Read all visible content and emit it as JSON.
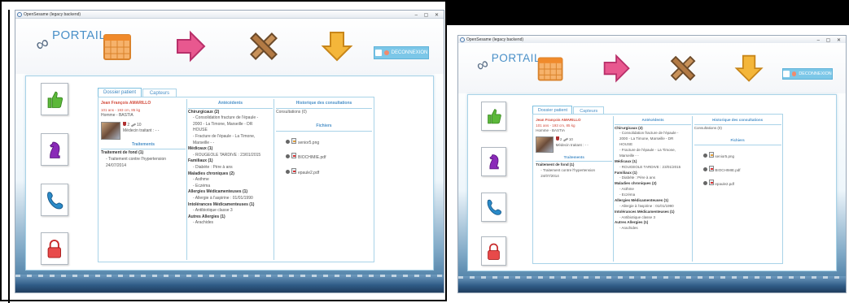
{
  "window": {
    "title": "OpenSesame (legacy backend)",
    "controls": "–  ▢  ✕"
  },
  "header": {
    "logo_text": "PORTAIL",
    "nav_icons": [
      "calendar-icon",
      "arrow-right-icon",
      "tools-icon",
      "arrow-down-icon"
    ],
    "disconnect_label": "DECONNEXION"
  },
  "sidebar": {
    "icons": [
      "thumbs-up-icon",
      "chess-knight-icon",
      "phone-icon",
      "padlock-icon"
    ]
  },
  "tabs": [
    "Dossier patient",
    "Capteurs"
  ],
  "patient": {
    "name": "Jean François AMARILLO",
    "details": "101 ans - 193 cm, 85 kg",
    "sex_city": "Homme - BASTIA",
    "wine": "2",
    "cigarettes": "10",
    "doctor": "Médecin traitant : - -"
  },
  "treatments": {
    "header": "Traitements",
    "title": "Traitement de fond (1)",
    "item": "- Traitement contre l'hypertension",
    "date": "24/07/2014"
  },
  "antecedents": {
    "header": "Antécédents",
    "lines": [
      {
        "t": "Chirurgicaux (2)",
        "s": "b"
      },
      {
        "t": "- Consolidation fracture de l'épaule -",
        "s": "ind"
      },
      {
        "t": "2000 - La Timone, Marseille - DR",
        "s": "ind"
      },
      {
        "t": "HOUSE",
        "s": "ind"
      },
      {
        "t": "- Fracture de l'épaule - La Timone,",
        "s": "ind"
      },
      {
        "t": "Marseille - -",
        "s": "ind"
      },
      {
        "t": "Médicaux (1)",
        "s": "b"
      },
      {
        "t": "- ROUGEOLE TARDIVE : 23/01/2015",
        "s": "ind"
      },
      {
        "t": "Familiaux (1)",
        "s": "b"
      },
      {
        "t": "- Diabète : Père à ans",
        "s": "ind"
      },
      {
        "t": "Maladies chroniques (2)",
        "s": "b"
      },
      {
        "t": "- Asthme",
        "s": "ind"
      },
      {
        "t": "- Eczéma",
        "s": "ind"
      },
      {
        "t": "Allergies Médicamenteuses (1)",
        "s": "b"
      },
      {
        "t": "- Allergie à l'aspirine : 01/01/1990",
        "s": "ind"
      },
      {
        "t": "Intolérances Médicamenteuses (1)",
        "s": "b"
      },
      {
        "t": "- Antibiotique classe 3",
        "s": "ind"
      },
      {
        "t": "Autres Allergies (1)",
        "s": "b"
      },
      {
        "t": "- Arachides",
        "s": "ind"
      }
    ]
  },
  "history": {
    "header": "Historique des consultations",
    "count": "Consultations (0)"
  },
  "files": {
    "header": "Fichiers",
    "items": [
      {
        "name": "senior5.png",
        "type": "png"
      },
      {
        "name": "BIOCHIMIE.pdf",
        "type": "pdf"
      },
      {
        "name": "epaule2.pdf",
        "type": "pdf"
      }
    ]
  }
}
